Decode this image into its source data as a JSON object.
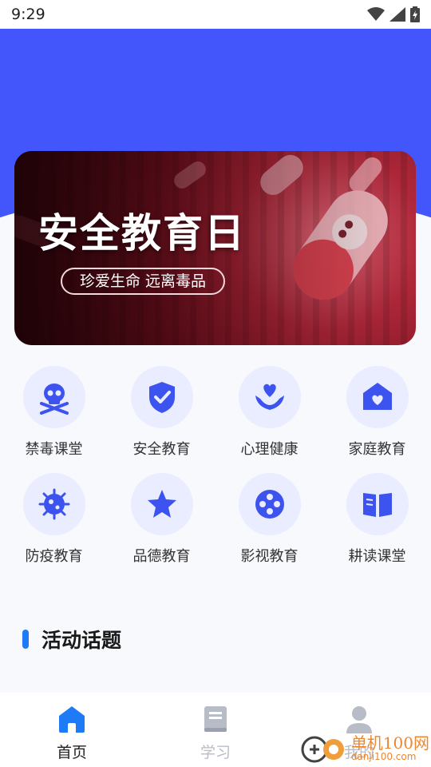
{
  "status_bar": {
    "time": "9:29"
  },
  "banner": {
    "title": "安全教育日",
    "subtitle": "珍爱生命 远离毒品"
  },
  "categories": [
    {
      "label": "禁毒课堂",
      "icon": "skull-crossbones-icon"
    },
    {
      "label": "安全教育",
      "icon": "shield-check-icon"
    },
    {
      "label": "心理健康",
      "icon": "heart-hands-icon"
    },
    {
      "label": "家庭教育",
      "icon": "home-heart-icon"
    },
    {
      "label": "防疫教育",
      "icon": "virus-icon"
    },
    {
      "label": "品德教育",
      "icon": "star-icon"
    },
    {
      "label": "影视教育",
      "icon": "film-reel-icon"
    },
    {
      "label": "耕读课堂",
      "icon": "open-book-icon"
    }
  ],
  "section": {
    "title": "活动话题"
  },
  "tabs": [
    {
      "label": "首页",
      "icon": "home-icon",
      "active": true
    },
    {
      "label": "学习",
      "icon": "book-icon",
      "active": false
    },
    {
      "label": "我的",
      "icon": "user-icon",
      "active": false
    }
  ],
  "watermark": {
    "name": "单机100网",
    "url": "danji100.com"
  },
  "colors": {
    "primary": "#4356fb",
    "accent": "#1e7bf5",
    "icon_bg": "#e9edff",
    "icon_fg": "#3d53f0"
  }
}
